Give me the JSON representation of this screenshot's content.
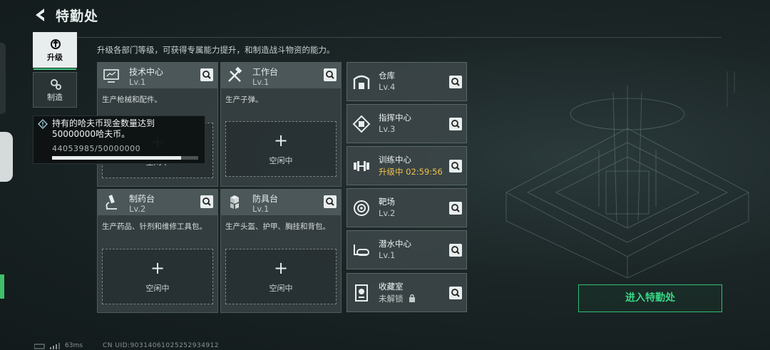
{
  "header": {
    "title": "特勤处"
  },
  "subtitle": "升级各部门等级，可获得专属能力提升，和制造战斗物资的能力。",
  "nav": [
    {
      "label": "升级",
      "icon": "upgrade-icon",
      "active": true
    },
    {
      "label": "制造",
      "icon": "gears-icon",
      "active": false
    }
  ],
  "cards": [
    {
      "name": "技术中心",
      "level": "Lv.1",
      "desc": "生产枪械和配件。",
      "icon": "computer-icon",
      "slot": "空闲中"
    },
    {
      "name": "工作台",
      "level": "Lv.1",
      "desc": "生产子弹。",
      "icon": "tools-icon",
      "slot": "空闲中"
    },
    {
      "name": "制药台",
      "level": "Lv.2",
      "desc": "生产药品、针剂和维修工具包。",
      "icon": "microscope-icon",
      "slot": "空闲中"
    },
    {
      "name": "防具台",
      "level": "Lv.1",
      "desc": "生产头盔、护甲、胸挂和背包。",
      "icon": "armor-cubes-icon",
      "slot": "空闲中"
    }
  ],
  "right_cards": [
    {
      "name": "仓库",
      "status": "Lv.4",
      "icon": "warehouse-icon"
    },
    {
      "name": "指挥中心",
      "status": "Lv.3",
      "icon": "chip-icon"
    },
    {
      "name": "训练中心",
      "status": "升级中 02:59:56",
      "icon": "dumbbell-icon",
      "upgrading": true
    },
    {
      "name": "靶场",
      "status": "Lv.2",
      "icon": "target-icon"
    },
    {
      "name": "潜水中心",
      "status": "Lv.1",
      "icon": "diving-icon"
    },
    {
      "name": "收藏室",
      "status": "未解锁",
      "icon": "collection-icon",
      "locked": true
    }
  ],
  "tooltip": {
    "text": "持有的哈夫币现金数量达到50000000哈夫币。",
    "progress_text": "44053985/50000000",
    "progress_fraction": 0.881
  },
  "enter_button": "进入特勤处",
  "status": {
    "ping": "63ms",
    "uid": "CN UID:9031406102525293491​2"
  },
  "colors": {
    "accent": "#36d985",
    "upgrading": "#f0c24a"
  }
}
